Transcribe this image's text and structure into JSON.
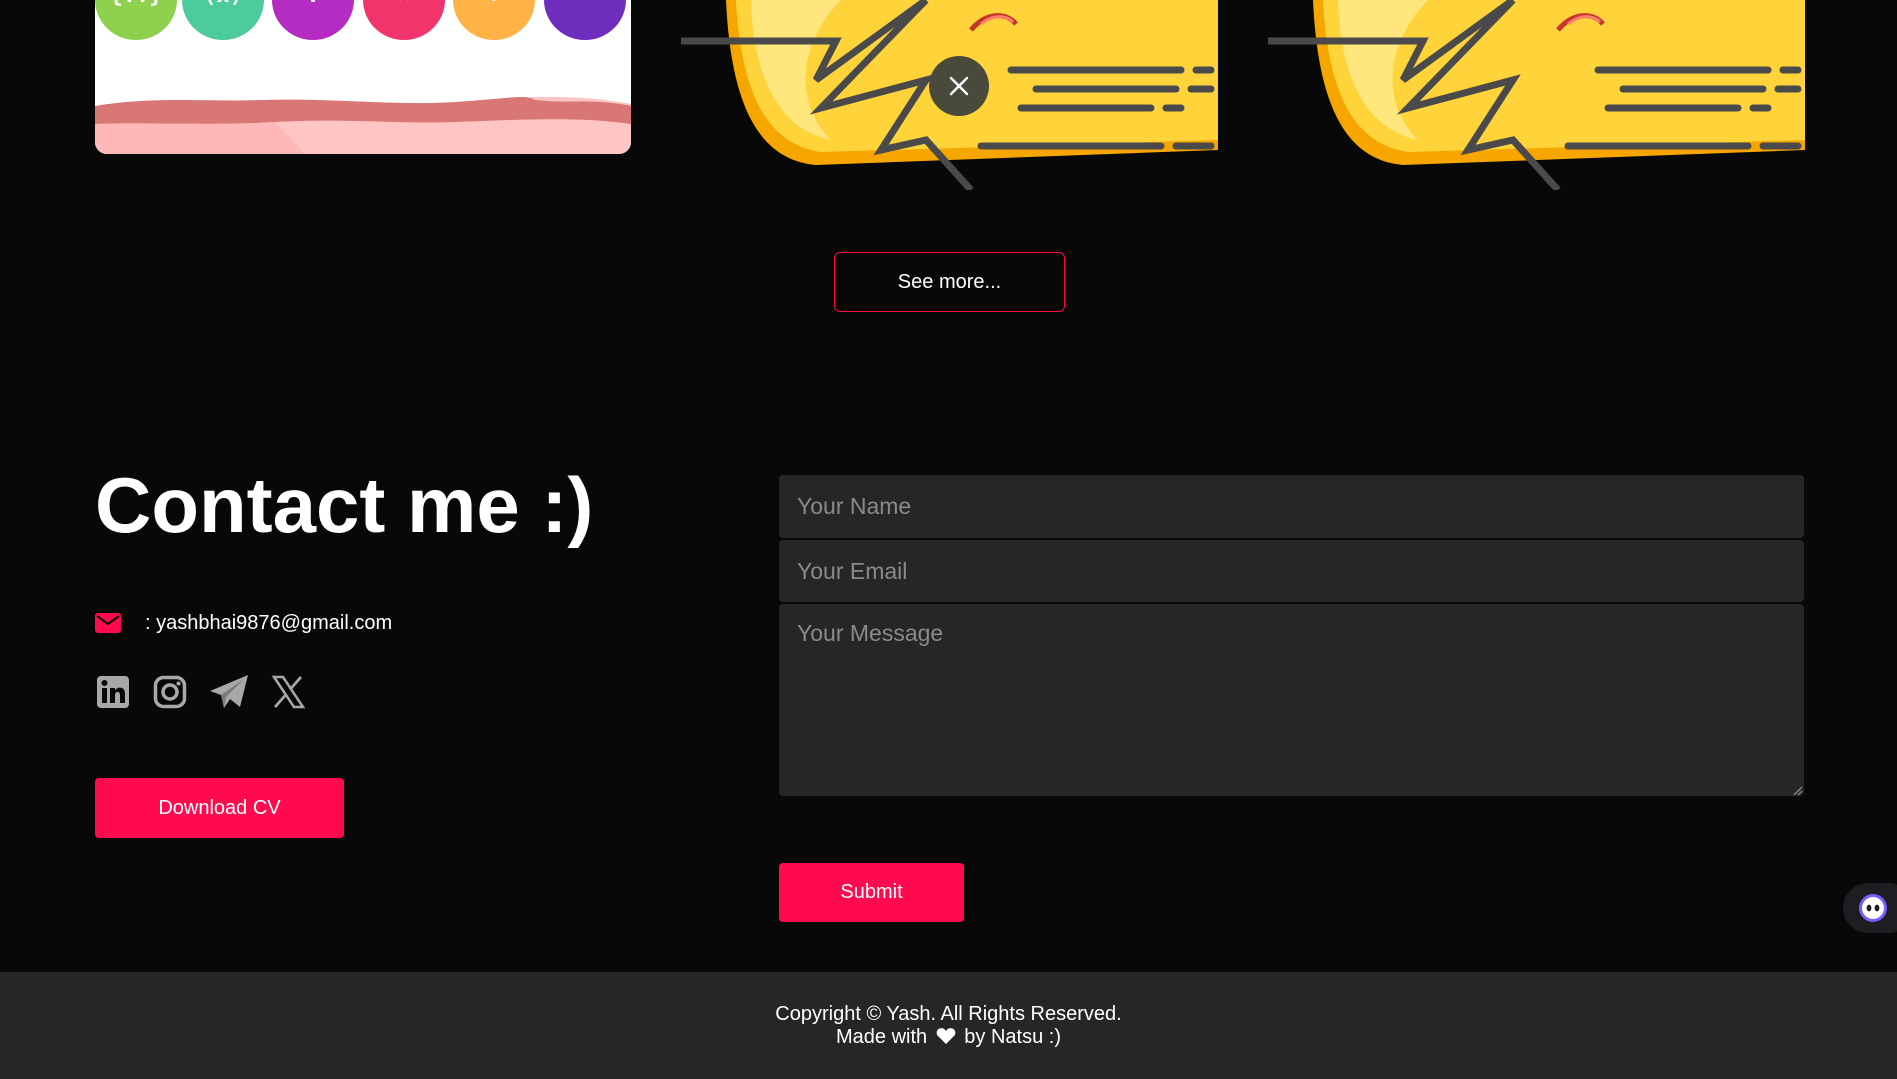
{
  "projects": {
    "symbol_circles": [
      {
        "glyph": "{..}",
        "color": "#8fd14f"
      },
      {
        "glyph": "(x)",
        "color": "#4ecb9a"
      },
      {
        "glyph": ":",
        "color": "#b52cc2"
      },
      {
        "glyph": "×",
        "color": "#f2346c"
      },
      {
        "glyph": "+",
        "color": "#ffb347"
      },
      {
        "glyph": "−",
        "color": "#6f2dbd"
      }
    ],
    "close_icon": "close-icon",
    "see_more_label": "See more..."
  },
  "contact": {
    "title": "Contact me :)",
    "email_text": ": yashbhai9876@gmail.com",
    "socials": [
      {
        "name": "linkedin-icon"
      },
      {
        "name": "instagram-icon"
      },
      {
        "name": "telegram-icon"
      },
      {
        "name": "x-twitter-icon"
      }
    ],
    "download_cv_label": "Download CV"
  },
  "form": {
    "name_placeholder": "Your Name",
    "email_placeholder": "Your Email",
    "message_placeholder": "Your Message",
    "submit_label": "Submit"
  },
  "footer": {
    "copyright": "Copyright © Yash. All Rights Reserved.",
    "made_with_prefix": "Made with",
    "made_with_suffix": "by Natsu :)"
  },
  "colors": {
    "accent": "#ff0a4f",
    "background": "#080808",
    "field_bg": "#262626",
    "footer_bg": "#262626"
  }
}
